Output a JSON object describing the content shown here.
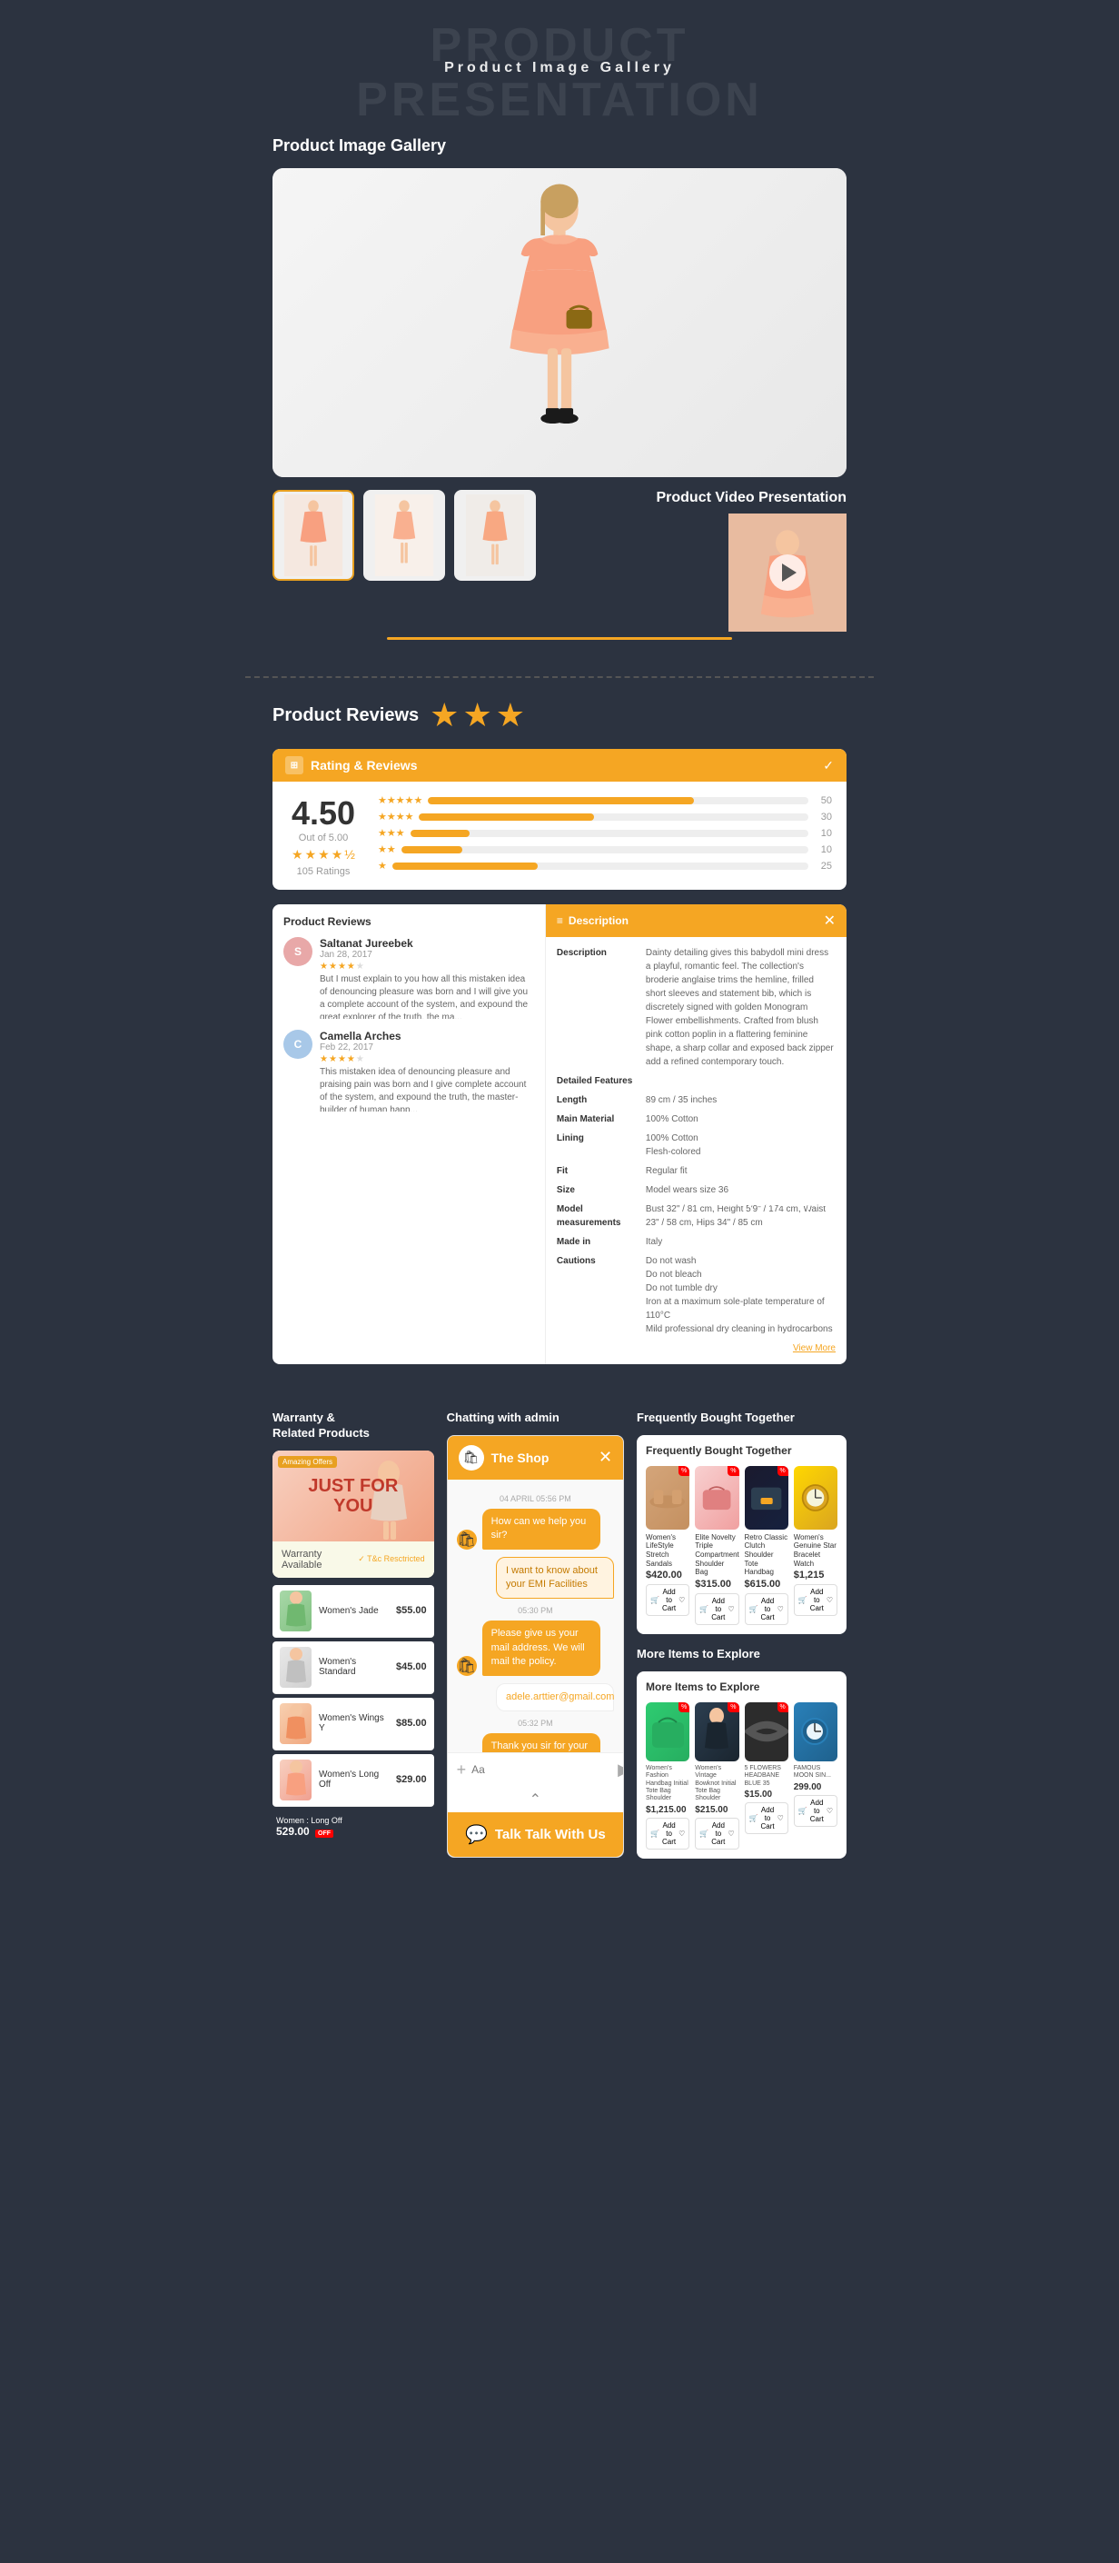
{
  "header": {
    "watermark": "PRODUCT PRESENTATION",
    "subtitle": "Product Image Gallery"
  },
  "gallery": {
    "section_title": "Product Image Gallery",
    "video_title": "Product Video Presentation",
    "thumbnails": [
      {
        "id": 1,
        "label": "thumb-1",
        "active": true
      },
      {
        "id": 2,
        "label": "thumb-2",
        "active": false
      },
      {
        "id": 3,
        "label": "thumb-3",
        "active": false
      }
    ]
  },
  "reviews": {
    "section_title": "Product Reviews",
    "header_label": "Rating & Reviews",
    "score": "4.50",
    "score_subtitle": "Out of 5.00",
    "ratings_count": "105 Ratings",
    "bars": [
      {
        "stars": "★★★★★",
        "count": "50",
        "width": "70"
      },
      {
        "stars": "★★★★",
        "count": "30",
        "width": "45"
      },
      {
        "stars": "★★★",
        "count": "10",
        "width": "15"
      },
      {
        "stars": "★★",
        "count": "10",
        "width": "15"
      },
      {
        "stars": "★",
        "count": "25",
        "width": "35"
      }
    ],
    "reviewer_1": {
      "name": "Saltanat Jureebek",
      "date": "Jan 28, 2017",
      "stars": 4,
      "text": "But I must explain to you how all this mistaken idea of denouncing pleasure was born and I will give you a complete account of the system, and expound the great explorer of the truth, the ma..."
    },
    "reviewer_2": {
      "name": "Camella Arches",
      "date": "Feb 22, 2017",
      "stars": 4,
      "text": "This mistaken idea of denouncing pleasure and praising pain was born and I give complete account of the system, and expound the truth, the master-builder of human happ..."
    }
  },
  "description": {
    "label": "Description",
    "main_text": "Dainty detailing gives this babydoll mini dress a playful, romantic feel. The collection's broderie anglaise trims the hemline, frilled short sleeves and statement bib, which is discretely signed with golden Monogram Flower embellishments. Crafted from blush pink cotton poplin in a flattering feminine shape, a sharp collar and exposed back zipper add a refined contemporary touch.",
    "detailed_features": "Length",
    "length": "89 cm / 35 inches",
    "main_material": "100% Cotton",
    "lining": "100% Cotton",
    "lining_value": "Flesh-colored",
    "fit": "Regular fit",
    "size": "Model wears size 36",
    "measurements": "Bust 32\" / 81 cm, Height 5'9\" / 174 cm, Waist 23\" / 58 cm, Hips 34\" / 85 cm",
    "made_in": "Italy",
    "cautions": "Do not wash\nDo not bleach\nDo not tumble dry\nIron at a maximum sole-plate temperature of 110°C\nMild professional dry cleaning in hydrocarbons",
    "view_more": "View More"
  },
  "warranty": {
    "col_title": "Warranty &\nRelated Products",
    "banner_text": "JUST FOR\nYOU",
    "banner_badge": "Amazing Offers",
    "warranty_label": "Warranty",
    "warranty_value": "Available",
    "warranty_link": "✓ T&c Resctricted",
    "related_title": "Related Products",
    "related_items": [
      {
        "name": "Women's Jade",
        "price": "$55.00"
      },
      {
        "name": "Women's Standard",
        "price": "$45.00"
      },
      {
        "name": "Women's Wings Y",
        "price": "$85.00"
      },
      {
        "name": "Women's Long Off",
        "price": "$29.00"
      }
    ]
  },
  "chat": {
    "col_title": "Chatting with admin",
    "header_name": "The Shop",
    "msg_1_time": "04 APRIL 05:56 PM",
    "msg_1_text": "How can we help you sir?",
    "msg_2_text": "I want to know about your EMI Facilities",
    "msg_3_time": "05:30 PM",
    "msg_3_text": "Please give us your mail address. We will mail the policy.",
    "msg_4_email": "adele.arttier@gmail.com",
    "msg_5_time": "05:32 PM",
    "msg_5_text": "Thank you sir for your interest.",
    "input_placeholder": "Aa",
    "footer_text": "Talk With Us",
    "scroll_hint": "⌃"
  },
  "frequently_bought": {
    "col_title": "Frequently Bought Together",
    "card_title": "Frequently Bought Together",
    "products": [
      {
        "name": "Women's LifeStyle Stretch Sandals",
        "price": "$420.00",
        "color": "swatch-tan"
      },
      {
        "name": "Elite Novelty Triple Compartment Shoulder Bag",
        "price": "$315.00",
        "color": "swatch-pink"
      },
      {
        "name": "Retro Classic Clutch Shoulder Tote Handbag",
        "price": "$615.00",
        "color": "swatch-dark"
      },
      {
        "name": "Women's Genuine Star Bracelet Watch",
        "price": "$1,215",
        "color": "swatch-gold"
      }
    ],
    "more_items_title": "More Items to Explore",
    "more_card_title": "More Items to Explore",
    "more_products": [
      {
        "name": "Women's Fashion Handbag Initial Tote Bag Shoulder",
        "price": "$1,215.00",
        "color": "swatch-green"
      },
      {
        "name": "Women's Vintage Bowknot Initial Tote Bag Shoulder",
        "price": "$215.00",
        "color": "swatch-black"
      },
      {
        "name": "5 FLOWERS HEADBANE BLUE 35",
        "price": "$15.00",
        "color": "swatch-dark"
      },
      {
        "name": "FAMOUS MOON SIN...",
        "price": "299.00",
        "color": "swatch-blue"
      }
    ]
  },
  "add_to_cart_label": "Add to Cart",
  "women_long_label": "Women : Long Off",
  "women_long_price": "529.00",
  "with_us_label": "With Us"
}
